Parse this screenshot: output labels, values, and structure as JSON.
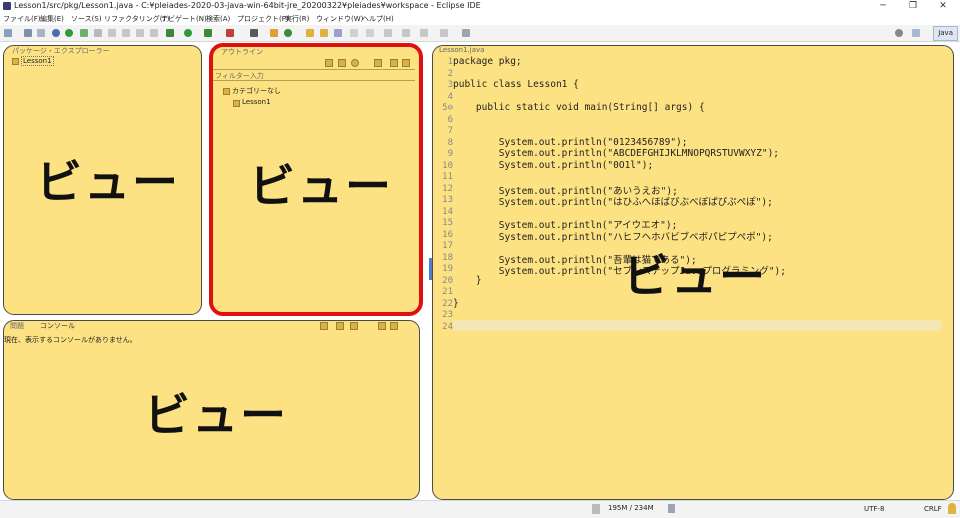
{
  "window": {
    "title": "Lesson1/src/pkg/Lesson1.java - C:¥pleiades-2020-03-java-win-64bit-jre_20200322¥pleiades¥workspace - Eclipse IDE",
    "minimize": "─",
    "maximize": "❐",
    "close": "✕"
  },
  "menu": [
    "ファイル(F)",
    "編集(E)",
    "ソース(S)",
    "リファクタリング(T)",
    "ナビゲート(N)",
    "検索(A)",
    "プロジェクト(P)",
    "実行(R)",
    "ウィンドウ(W)",
    "ヘルプ(H)"
  ],
  "toolbar": {
    "perspective": "Java"
  },
  "package_explorer": {
    "tab": "パッケージ・エクスプローラー",
    "project": "Lesson1",
    "overlay": "ビュー"
  },
  "outline": {
    "tab": "アウトライン",
    "filter_placeholder": "フィルター入力",
    "category": "カテゴリーなし",
    "item": "Lesson1",
    "overlay": "ビュー"
  },
  "console": {
    "tab_problems": "問題",
    "tab_console": "コンソール",
    "message": "現在、表示するコンソールがありません。",
    "overlay": "ビュー"
  },
  "editor": {
    "tab": "Lesson1.java",
    "overlay": "ビュー",
    "lines": [
      {
        "n": "1",
        "t": "package pkg;"
      },
      {
        "n": "2",
        "t": ""
      },
      {
        "n": "3",
        "t": "public class Lesson1 {"
      },
      {
        "n": "4",
        "t": ""
      },
      {
        "n": "5⊖",
        "t": "    public static void main(String[] args) {"
      },
      {
        "n": "6",
        "t": ""
      },
      {
        "n": "7",
        "t": ""
      },
      {
        "n": "8",
        "t": "        System.out.println(\"0123456789\");"
      },
      {
        "n": "9",
        "t": "        System.out.println(\"ABCDEFGHIJKLMNOPQRSTUVWXYZ\");"
      },
      {
        "n": "10",
        "t": "        System.out.println(\"0O1l\");"
      },
      {
        "n": "11",
        "t": ""
      },
      {
        "n": "12",
        "t": "        System.out.println(\"あいうえお\");"
      },
      {
        "n": "13",
        "t": "        System.out.println(\"はひふへほばびぶべぼぱぴぷぺぽ\");"
      },
      {
        "n": "14",
        "t": ""
      },
      {
        "n": "15",
        "t": "        System.out.println(\"アイウエオ\");"
      },
      {
        "n": "16",
        "t": "        System.out.println(\"ハヒフヘホバビブベボパピプペポ\");"
      },
      {
        "n": "17",
        "t": ""
      },
      {
        "n": "18",
        "t": "        System.out.println(\"吾輩は猫である\");"
      },
      {
        "n": "19",
        "t": "        System.out.println(\"セブンステップJavaプログラミング\");"
      },
      {
        "n": "20",
        "t": "    }"
      },
      {
        "n": "21",
        "t": ""
      },
      {
        "n": "22",
        "t": "}"
      },
      {
        "n": "23",
        "t": ""
      },
      {
        "n": "24",
        "t": ""
      }
    ]
  },
  "status": {
    "memory": "195M / 234M",
    "encoding": "UTF-8",
    "line_ending": "CRLF"
  },
  "colors": {
    "view_fill": "#fde283",
    "highlight_border": "#e01010"
  }
}
